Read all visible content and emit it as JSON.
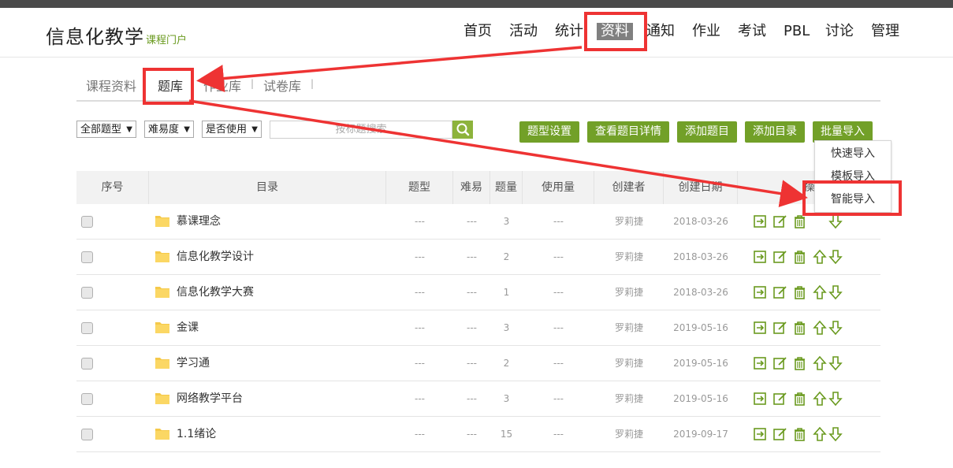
{
  "header": {
    "brand": "信息化教学",
    "brand_sub": "课程门户",
    "nav": [
      "首页",
      "活动",
      "统计",
      "资料",
      "通知",
      "作业",
      "考试",
      "PBL",
      "讨论",
      "管理"
    ]
  },
  "subtabs": [
    "课程资料",
    "题库",
    "作业库",
    "试卷库"
  ],
  "filters": {
    "type": "全部题型",
    "difficulty": "难易度",
    "used": "是否使用",
    "search_placeholder": "按标题搜索"
  },
  "buttons": [
    "题型设置",
    "查看题目详情",
    "添加题目",
    "添加目录",
    "批量导入"
  ],
  "import_menu": [
    "快速导入",
    "模板导入",
    "智能导入"
  ],
  "table": {
    "columns": [
      "序号",
      "目录",
      "题型",
      "难易",
      "题量",
      "使用量",
      "创建者",
      "创建日期",
      "操"
    ],
    "rows": [
      {
        "name": "慕课理念",
        "type": "---",
        "diff": "---",
        "count": "3",
        "used": "---",
        "creator": "罗莉捷",
        "date": "2018-03-26"
      },
      {
        "name": "信息化教学设计",
        "type": "---",
        "diff": "---",
        "count": "2",
        "used": "---",
        "creator": "罗莉捷",
        "date": "2018-03-26"
      },
      {
        "name": "信息化教学大赛",
        "type": "---",
        "diff": "---",
        "count": "1",
        "used": "---",
        "creator": "罗莉捷",
        "date": "2018-03-26"
      },
      {
        "name": "金课",
        "type": "---",
        "diff": "---",
        "count": "3",
        "used": "---",
        "creator": "罗莉捷",
        "date": "2019-05-16"
      },
      {
        "name": "学习通",
        "type": "---",
        "diff": "---",
        "count": "2",
        "used": "---",
        "creator": "罗莉捷",
        "date": "2019-05-16"
      },
      {
        "name": "网络教学平台",
        "type": "---",
        "diff": "---",
        "count": "3",
        "used": "---",
        "creator": "罗莉捷",
        "date": "2019-05-16"
      },
      {
        "name": "1.1绪论",
        "type": "---",
        "diff": "---",
        "count": "15",
        "used": "---",
        "creator": "罗莉捷",
        "date": "2019-09-17"
      }
    ]
  },
  "colors": {
    "accent": "#72a028",
    "annotation": "#ee3333",
    "topbar": "#4a4a4a"
  }
}
